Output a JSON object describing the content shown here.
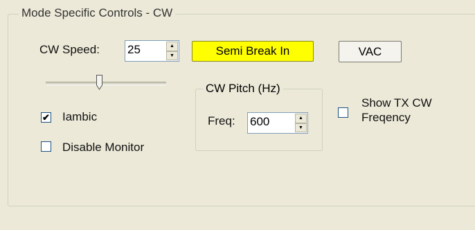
{
  "group": {
    "title": "Mode Specific Controls - CW"
  },
  "cw_speed": {
    "label": "CW Speed:",
    "value": "25"
  },
  "buttons": {
    "semi_break_in": "Semi Break In",
    "vac": "VAC"
  },
  "colors": {
    "semi_break_in_bg": "#ffff00",
    "panel_bg": "#ece9d8"
  },
  "iambic": {
    "label": "Iambic",
    "checked": true,
    "mark": "✔"
  },
  "disable_monitor": {
    "label": "Disable Monitor",
    "checked": false
  },
  "cw_pitch": {
    "title": "CW Pitch (Hz)",
    "freq_label": "Freq:",
    "freq_value": "600"
  },
  "show_tx": {
    "label_line1": "Show TX CW",
    "label_line2": "Freqency",
    "checked": false
  },
  "icons": {
    "spin_up": "▲",
    "spin_down": "▼"
  }
}
